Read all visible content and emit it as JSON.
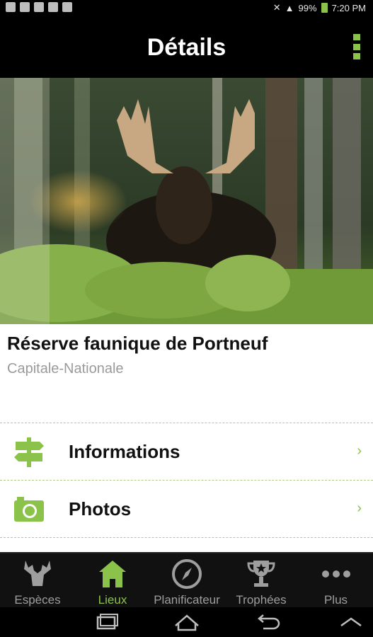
{
  "status_bar": {
    "battery": "99%",
    "time": "7:20 PM"
  },
  "app_bar": {
    "title": "Détails"
  },
  "place": {
    "name": "Réserve faunique de Portneuf",
    "region": "Capitale-Nationale"
  },
  "menu_items": [
    {
      "label": "Informations",
      "icon": "signpost-icon"
    },
    {
      "label": "Photos",
      "icon": "camera-icon"
    }
  ],
  "tabs": [
    {
      "label": "Espèces",
      "icon": "moose-icon",
      "active": false
    },
    {
      "label": "Lieux",
      "icon": "house-icon",
      "active": true
    },
    {
      "label": "Planificateur",
      "icon": "compass-icon",
      "active": false
    },
    {
      "label": "Trophées",
      "icon": "trophy-icon",
      "active": false
    },
    {
      "label": "Plus",
      "icon": "more-icon",
      "active": false
    }
  ],
  "colors": {
    "accent": "#8bc34a",
    "bar": "#000000",
    "tab_bg": "#111111"
  }
}
